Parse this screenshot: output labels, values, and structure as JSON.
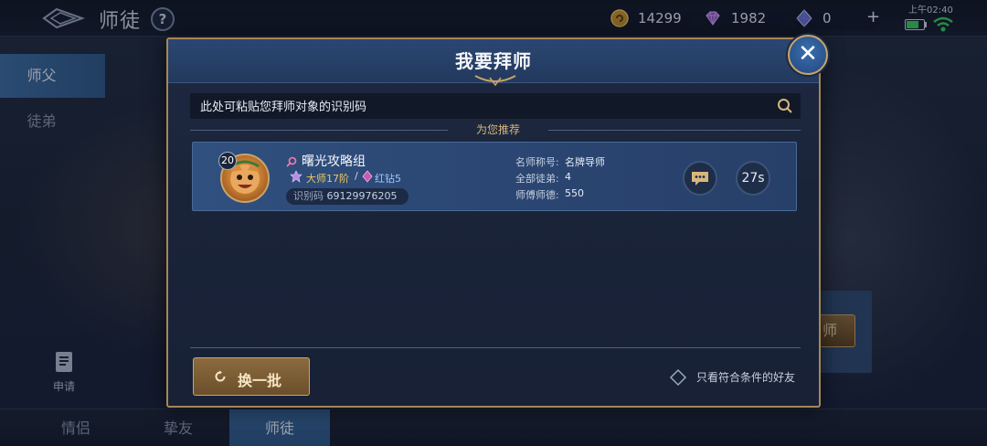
{
  "topbar": {
    "title": "师徒",
    "help": "?",
    "gold": "14299",
    "gems": "1982",
    "diamonds": "0",
    "plus": "+",
    "time": "上午02:40"
  },
  "sidebar": {
    "items": [
      {
        "label": "师父"
      },
      {
        "label": "徒弟"
      }
    ],
    "apply_label": "申请"
  },
  "bottom_tabs": [
    {
      "label": "情侣"
    },
    {
      "label": "挚友"
    },
    {
      "label": "师徒"
    }
  ],
  "background": {
    "partial_button": "师"
  },
  "dialog": {
    "title": "我要拜师",
    "close": "✕",
    "search_placeholder": "此处可粘贴您拜师对象的识别码",
    "recommend_label": "为您推荐",
    "card": {
      "level": "20",
      "name": "曙光攻略组",
      "rank": "大师17阶",
      "separator": "/",
      "vip": "红钻5",
      "id_label": "识别码",
      "id_value": "69129976205",
      "stats": [
        {
          "label": "名师称号:",
          "value": "名牌导师"
        },
        {
          "label": "全部徒弟:",
          "value": "4"
        },
        {
          "label": "师傅师德:",
          "value": "550"
        }
      ],
      "timer": "27s"
    },
    "refresh_label": "换一批",
    "friend_filter_label": "只看符合条件的好友"
  },
  "colors": {
    "accent_gold": "#c9a46a",
    "header_blue": "#2a4772",
    "active_tab": "#3a6ba0",
    "rank_gold": "#f0c95a",
    "vip_blue": "#9ec7ff",
    "battery": "#38d060"
  },
  "battery": {
    "level": 0.7
  },
  "icons": {
    "back": "back-arrow-icon",
    "gold": "gold-coin-icon",
    "gem": "purple-gem-icon",
    "diamond": "diamond-icon",
    "search": "search-icon",
    "chat": "chat-bubble-icon",
    "refresh": "refresh-icon",
    "apply": "document-icon",
    "wifi": "wifi-icon"
  }
}
